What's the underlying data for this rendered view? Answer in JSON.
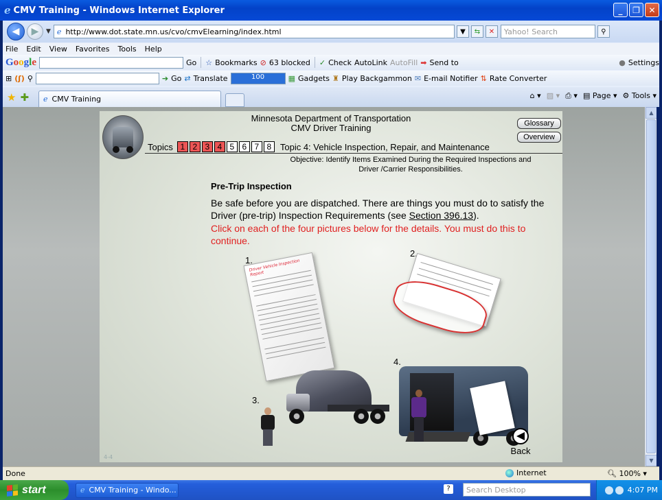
{
  "window": {
    "title": "CMV Training - Windows Internet Explorer"
  },
  "address_bar": {
    "url": "http://www.dot.state.mn.us/cvo/cmvElearning/index.html",
    "search_placeholder": "Yahoo! Search"
  },
  "menu": [
    "File",
    "Edit",
    "View",
    "Favorites",
    "Tools",
    "Help"
  ],
  "google_toolbar": {
    "go_label": "Go",
    "bookmarks_label": "Bookmarks",
    "blocked_label": "63 blocked",
    "check_label": "Check",
    "autolink_label": "AutoLink",
    "autofill_label": "AutoFill",
    "send_to_label": "Send to",
    "settings_label": "Settings"
  },
  "toolbar2": {
    "go_label": "Go",
    "translate_label": "Translate",
    "zoom_value": "100",
    "gadgets_label": "Gadgets",
    "backgammon_label": "Play Backgammon",
    "email_notifier_label": "E-mail Notifier",
    "rate_converter_label": "Rate Converter"
  },
  "tabs": {
    "active_tab_label": "CMV Training",
    "page_label": "Page",
    "tools_label": "Tools"
  },
  "content": {
    "org_line1": "Minnesota Department of Transportation",
    "org_line2": "CMV Driver Training",
    "glossary_label": "Glossary",
    "overview_label": "Overview",
    "topics_label": "Topics",
    "topic_numbers": [
      "1",
      "2",
      "3",
      "4",
      "5",
      "6",
      "7",
      "8"
    ],
    "topics_completed": [
      "1",
      "2",
      "3",
      "4"
    ],
    "topic_title": "Topic 4: Vehicle Inspection, Repair, and Maintenance",
    "objective_line1": "Objective: Identify Items Examined During the Required Inspections and",
    "objective_line2": "Driver /Carrier Responsibilities.",
    "section_title": "Pre-Trip Inspection",
    "body_before_link": "Be safe before you are dispatched. There are things you must do to satisfy the Driver (pre-trip) Inspection Requirements (see ",
    "section_link": "Section 396.13",
    "body_after_link": ").",
    "instruction": "Click on each of the four pictures below for the details. You must do this to continue.",
    "picture_labels": [
      "1.",
      "2.",
      "3.",
      "4."
    ],
    "doc1_header": "Driver Vehicle Inspection Report",
    "back_label": "Back",
    "page_number": "4-4"
  },
  "status_bar": {
    "status_text": "Done",
    "zone_label": "Internet",
    "zoom_label": "100%"
  },
  "taskbar": {
    "start_label": "start",
    "task_item_label": "CMV Training - Windo...",
    "desktop_search_placeholder": "Search Desktop",
    "clock": "4:07 PM"
  },
  "colors": {
    "topic_completed": "#ec5555",
    "instruction_text": "#e02020",
    "title_bar": "#0342c8"
  }
}
